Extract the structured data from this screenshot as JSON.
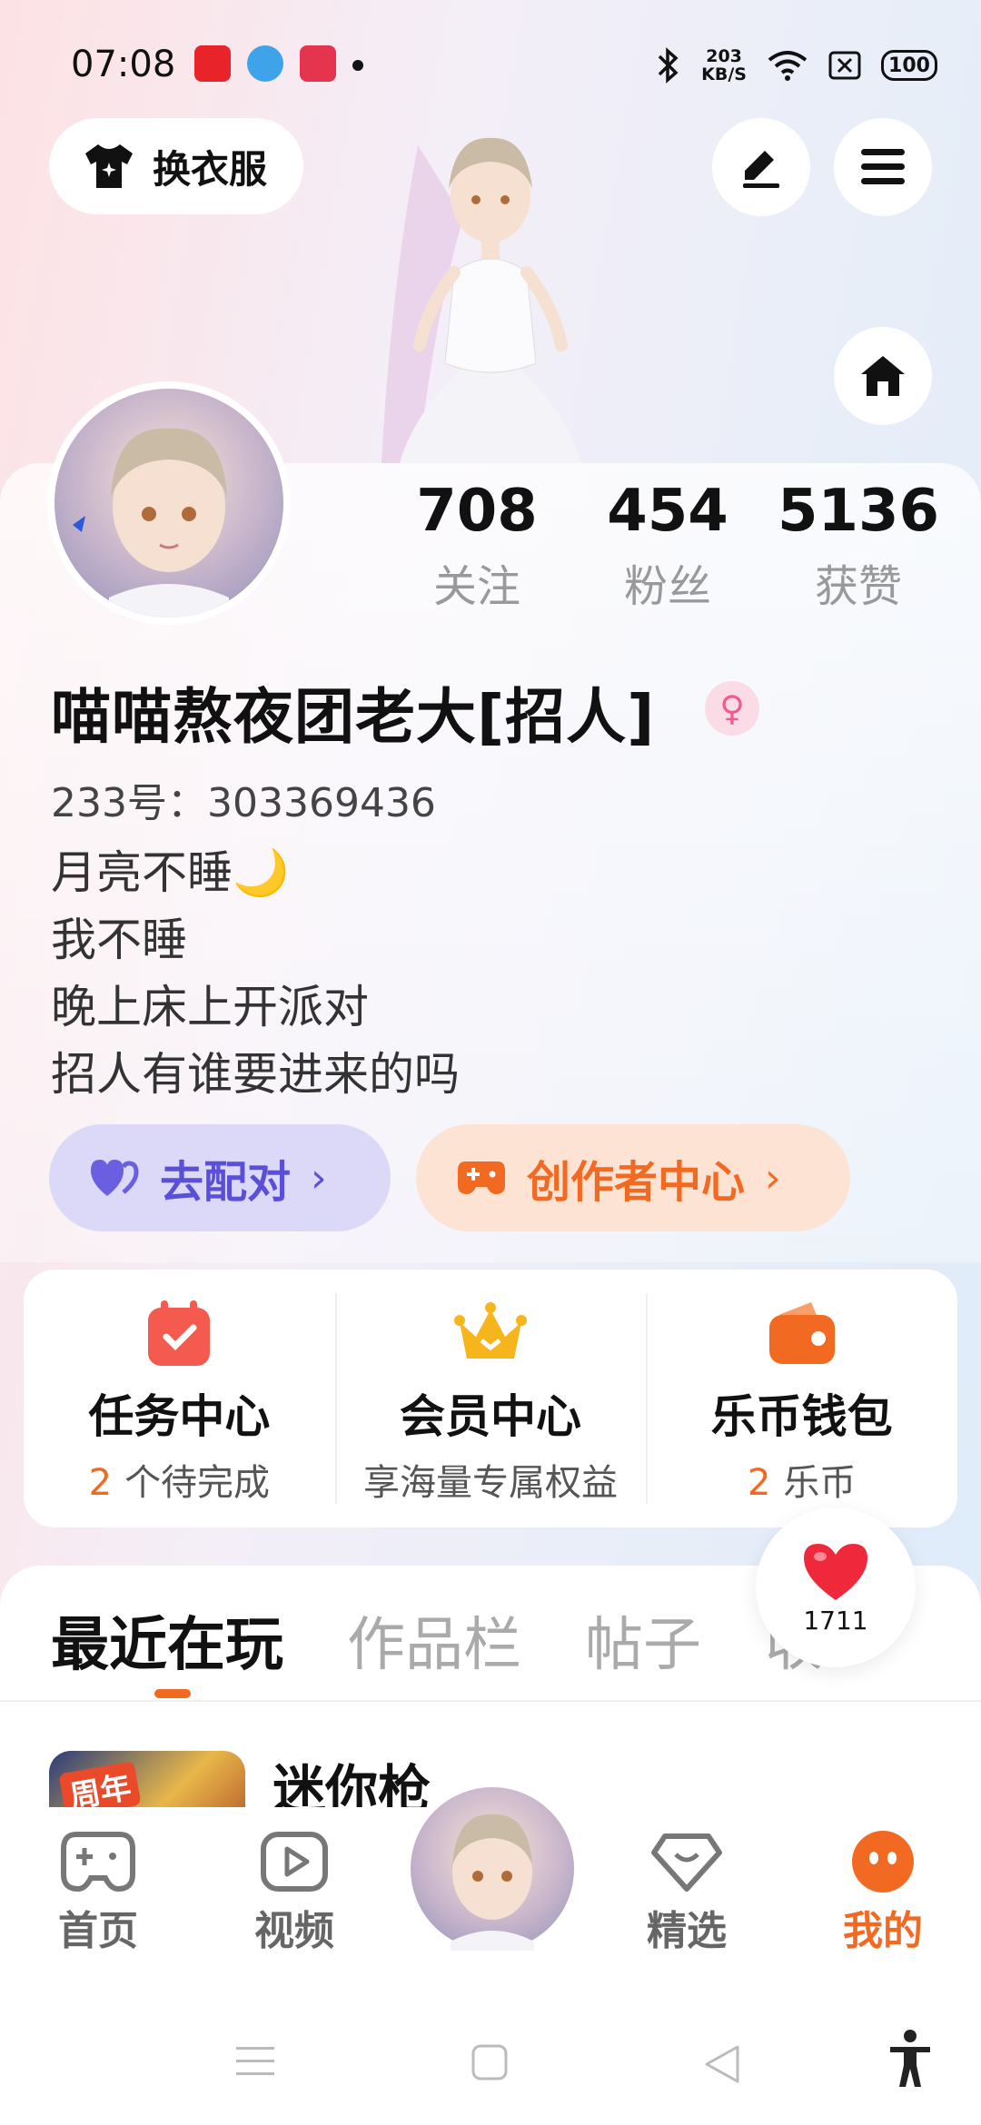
{
  "status_bar": {
    "time": "07:08",
    "speed_value": "203",
    "speed_unit": "KB/S",
    "battery": "100"
  },
  "header": {
    "outfit_label": "换衣服"
  },
  "stats": [
    {
      "value": "708",
      "label": "关注"
    },
    {
      "value": "454",
      "label": "粉丝"
    },
    {
      "value": "5136",
      "label": "获赞"
    }
  ],
  "profile": {
    "nickname": "喵喵熬夜团老大[招人]",
    "uid": "233号：303369436",
    "bio": [
      "月亮不睡🌙",
      "我不睡",
      "晚上床上开派对",
      "招人有谁要进来的吗"
    ]
  },
  "actions": {
    "match_label": "去配对",
    "creator_label": "创作者中心",
    "arrow": "›"
  },
  "services": [
    {
      "title": "任务中心",
      "count": "2",
      "sub": "个待完成",
      "icon": "calendar-check-icon"
    },
    {
      "title": "会员中心",
      "count": "",
      "sub": "享海量专属权益",
      "icon": "crown-icon"
    },
    {
      "title": "乐币钱包",
      "count": "2",
      "sub": "乐币",
      "icon": "wallet-icon"
    }
  ],
  "tabs": [
    "最近在玩",
    "作品栏",
    "帖子",
    "收"
  ],
  "recent_game": {
    "title": "迷你枪",
    "badge": "周年"
  },
  "like_bubble": {
    "count": "1711"
  },
  "bottom_nav": [
    {
      "label": "首页",
      "icon": "gamepad-icon"
    },
    {
      "label": "视频",
      "icon": "video-play-icon"
    },
    {
      "label": "精选",
      "icon": "heart-chat-icon"
    },
    {
      "label": "我的",
      "icon": "face-icon"
    }
  ],
  "colors": {
    "accent": "#f26a22",
    "match": "#5a4fd8",
    "match_bg": "#dcd8f8",
    "creator_bg": "#fde3d4",
    "gender": "#ee5d8c"
  }
}
